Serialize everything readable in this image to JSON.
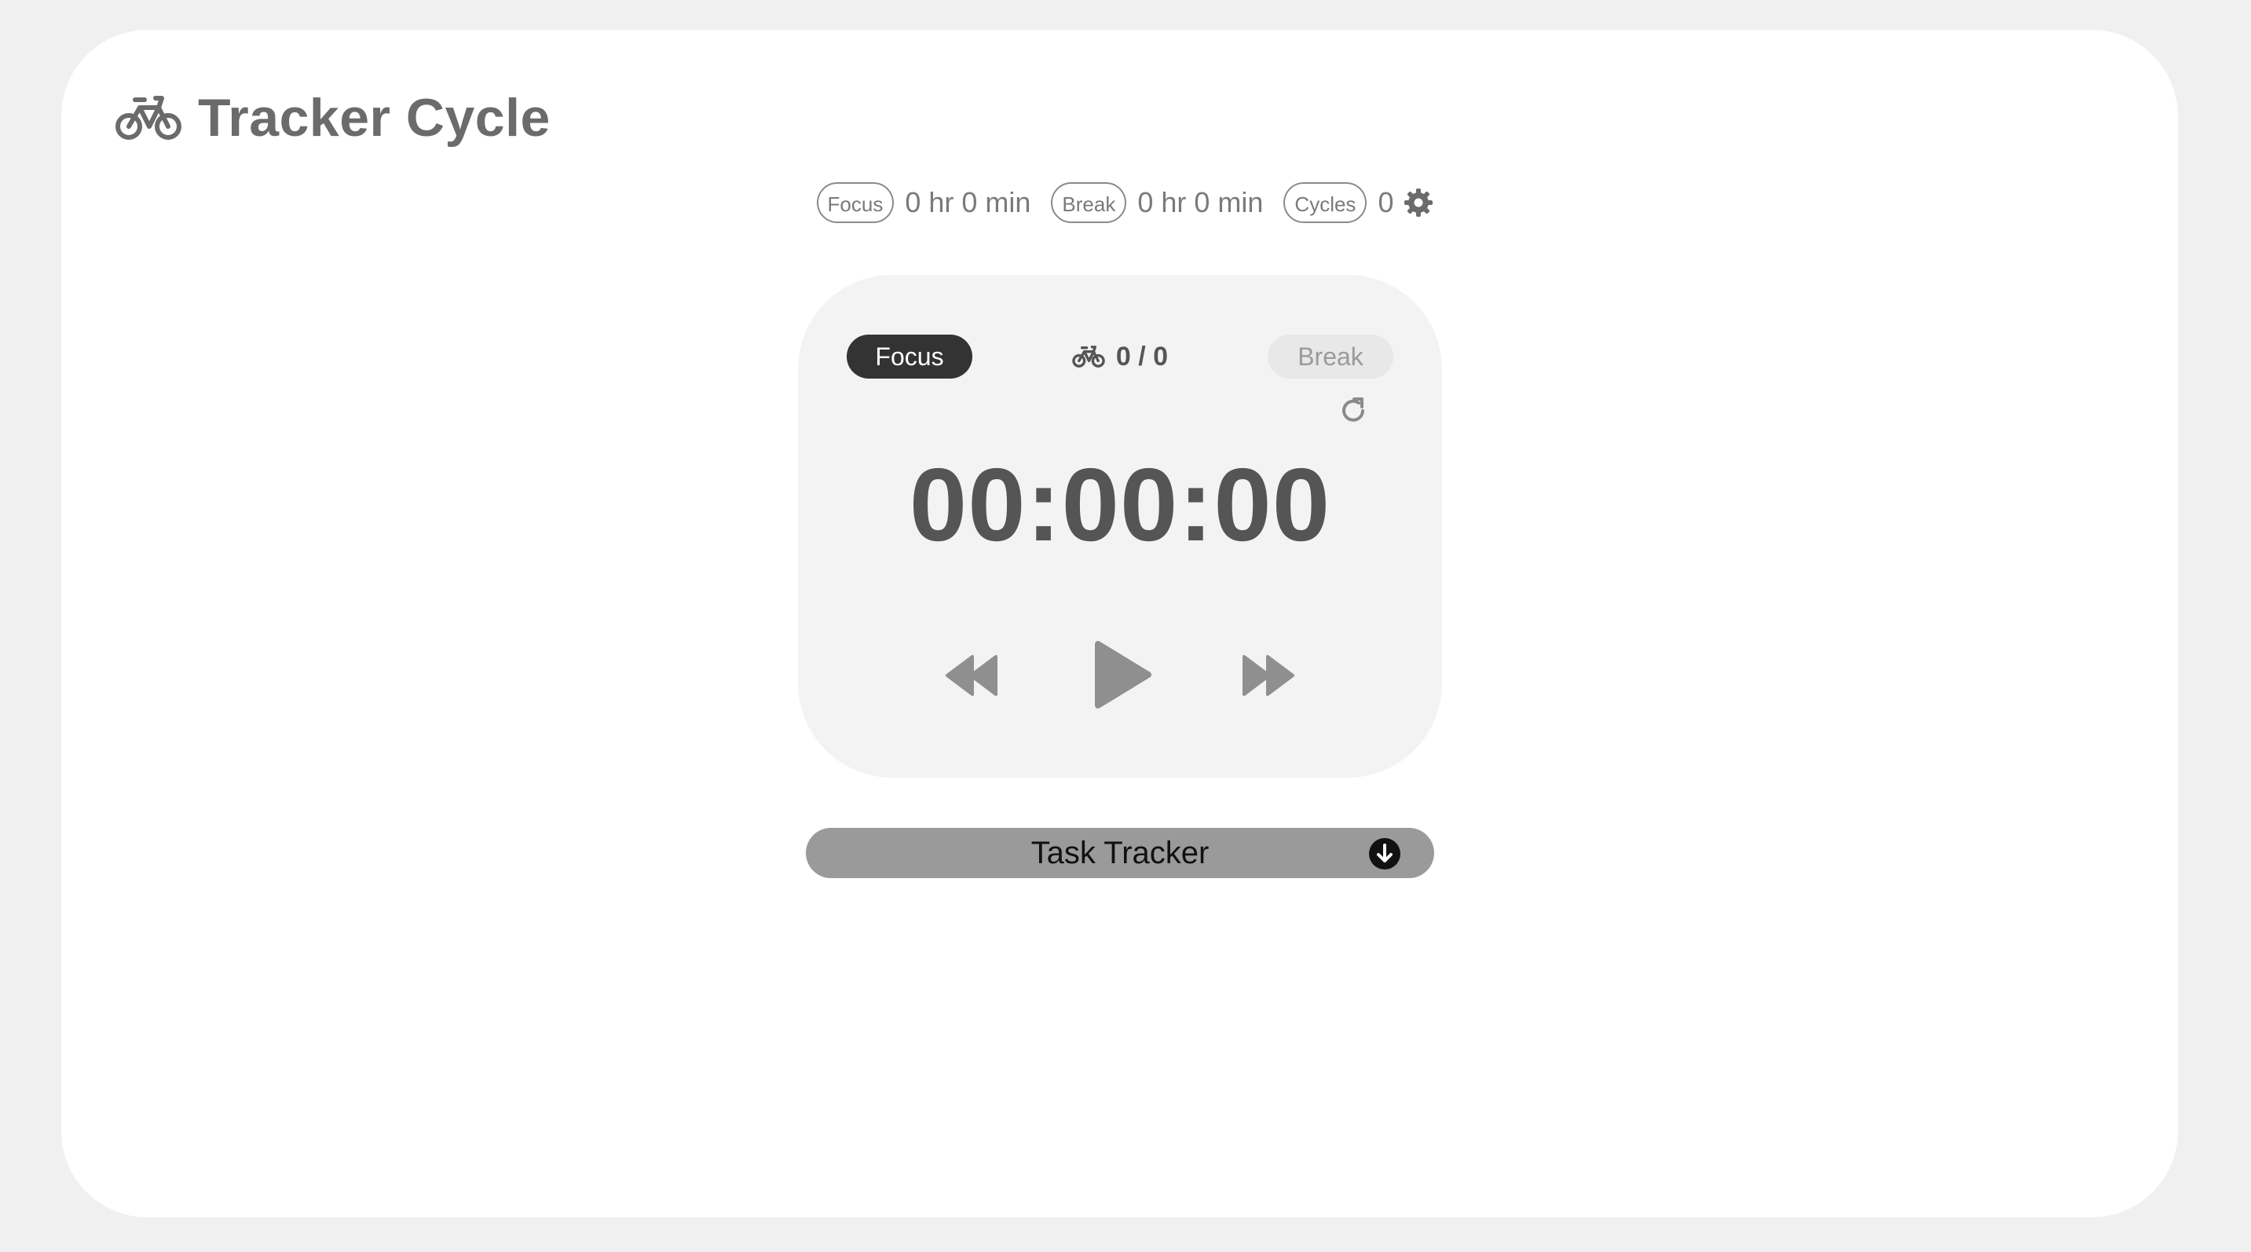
{
  "app": {
    "title": "Tracker Cycle",
    "logo_icon": "bicycle-icon"
  },
  "stats": {
    "focus_label": "Focus",
    "focus_value": "0 hr 0 min",
    "break_label": "Break",
    "break_value": "0 hr 0 min",
    "cycles_label": "Cycles",
    "cycles_value": "0",
    "settings_icon": "gear-icon"
  },
  "timer": {
    "mode_focus_label": "Focus",
    "mode_break_label": "Break",
    "active_mode": "Focus",
    "cycle_progress": "0 / 0",
    "time": "00:00:00",
    "reset_icon": "rotate-right-icon",
    "controls": {
      "previous_icon": "backward-icon",
      "play_icon": "play-icon",
      "next_icon": "forward-icon"
    }
  },
  "task_tracker": {
    "label": "Task Tracker",
    "icon": "arrow-circle-down-icon"
  },
  "colors": {
    "page_background": "#f0f0f0",
    "card_background": "#ffffff",
    "timer_background": "#f3f3f4",
    "active_pill": "#333333",
    "inactive_pill": "#e8e8e8",
    "task_bar": "#9a9a9a",
    "text_muted": "#6b6b6b"
  }
}
